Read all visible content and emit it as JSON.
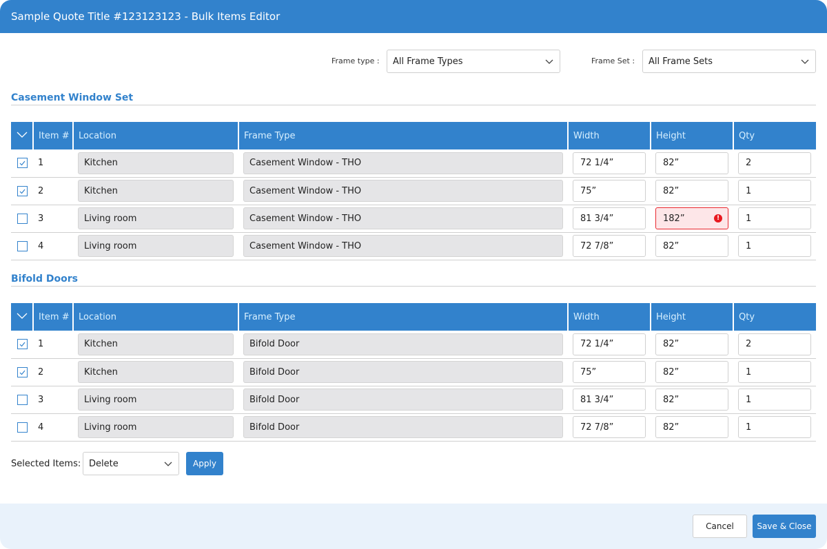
{
  "header": {
    "title": "Sample Quote Title #123123123 -  Bulk Items Editor"
  },
  "filters": {
    "frame_type": {
      "label": "Frame type :",
      "selected": "All Frame Types"
    },
    "frame_set": {
      "label": "Frame Set :",
      "selected": "All Frame Sets"
    }
  },
  "columns": {
    "item": "Item #",
    "location": "Location",
    "frame_type": "Frame Type",
    "width": "Width",
    "height": "Height",
    "qty": "Qty"
  },
  "sections": [
    {
      "title": "Casement Window  Set",
      "rows": [
        {
          "checked": true,
          "item": "1",
          "location": "Kitchen",
          "frame_type": "Casement Window - THO",
          "width": "72 1/4”",
          "height": "82”",
          "qty": "2",
          "height_error": false
        },
        {
          "checked": true,
          "item": "2",
          "location": "Kitchen",
          "frame_type": "Casement Window - THO",
          "width": "75”",
          "height": "82”",
          "qty": "1",
          "height_error": false
        },
        {
          "checked": false,
          "item": "3",
          "location": "Living room",
          "frame_type": "Casement Window - THO",
          "width": "81 3/4”",
          "height": "182”",
          "qty": "1",
          "height_error": true
        },
        {
          "checked": false,
          "item": "4",
          "location": "Living room",
          "frame_type": "Casement Window - THO",
          "width": "72 7/8”",
          "height": "82”",
          "qty": "1",
          "height_error": false
        }
      ]
    },
    {
      "title": "Bifold Doors",
      "rows": [
        {
          "checked": true,
          "item": "1",
          "location": "Kitchen",
          "frame_type": "Bifold Door",
          "width": "72 1/4”",
          "height": "82”",
          "qty": "2",
          "height_error": false
        },
        {
          "checked": true,
          "item": "2",
          "location": "Kitchen",
          "frame_type": "Bifold Door",
          "width": "75”",
          "height": "82”",
          "qty": "1",
          "height_error": false
        },
        {
          "checked": false,
          "item": "3",
          "location": "Living room",
          "frame_type": "Bifold Door",
          "width": "81 3/4”",
          "height": "82”",
          "qty": "1",
          "height_error": false
        },
        {
          "checked": false,
          "item": "4",
          "location": "Living room",
          "frame_type": "Bifold Door",
          "width": "72 7/8”",
          "height": "82”",
          "qty": "1",
          "height_error": false
        }
      ]
    }
  ],
  "bulk_actions": {
    "label": "Selected Items:",
    "selected": "Delete",
    "apply_label": "Apply"
  },
  "footer": {
    "cancel_label": "Cancel",
    "save_label": "Save & Close"
  },
  "error_icon_glyph": "!",
  "colors": {
    "primary": "#3282cc",
    "header_text": "#d8f0ff",
    "error_border": "#e8262d",
    "error_bg": "#fde6e8",
    "footer_bg": "#e9f2fb",
    "readonly_bg": "#e5e5e7"
  }
}
